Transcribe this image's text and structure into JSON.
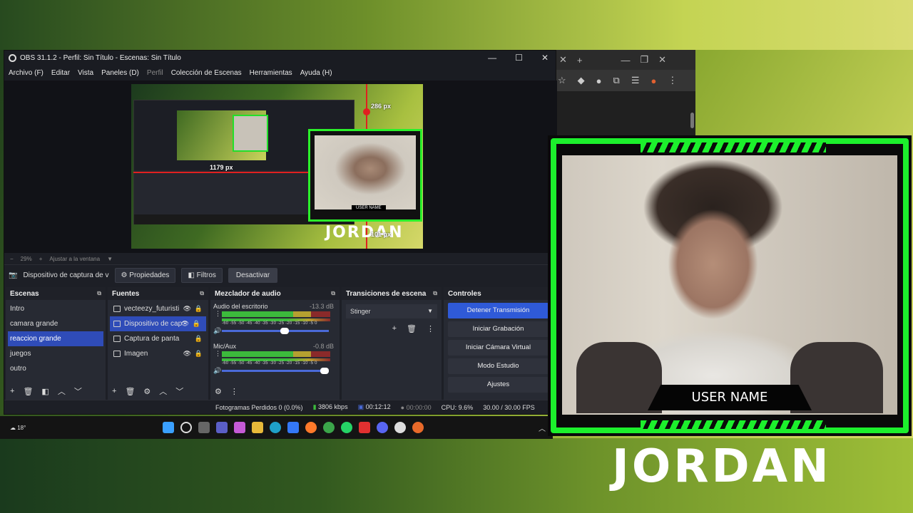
{
  "obs": {
    "title": "OBS 31.1.2 - Perfil: Sin Título - Escenas: Sin Título",
    "window_controls": [
      "—",
      "☐",
      "✕"
    ],
    "menu": [
      "Archivo (F)",
      "Editar",
      "Vista",
      "Paneles (D)",
      "Perfil",
      "Colección de Escenas",
      "Herramientas",
      "Ayuda (H)"
    ],
    "preview": {
      "measure_h": "1179 px",
      "measure_v_top": "286 px",
      "measure_v_bottom": "101 px",
      "cam_username": "USER NAME",
      "logo": "JORDAN"
    },
    "zoom": {
      "minus": "−",
      "value": "29%",
      "plus": "+",
      "fit": "Ajustar a la ventana"
    },
    "source_bar": {
      "selected": "Dispositivo de captura de v",
      "properties": "Propiedades",
      "filters": "Filtros",
      "deactivate": "Desactivar"
    },
    "scenes": {
      "title": "Escenas",
      "items": [
        "Intro",
        "camara grande",
        "reaccion grande",
        "juegos",
        "outro"
      ],
      "selected_index": 2
    },
    "sources": {
      "title": "Fuentes",
      "items": [
        "vecteezy_futuristi",
        "Dispositivo de cap",
        "Captura de panta",
        "Imagen"
      ],
      "selected_index": 1
    },
    "mixer": {
      "title": "Mezclador de audio",
      "channels": [
        {
          "name": "Audio del escritorio",
          "db": "-13.3 dB",
          "volume": 0.58
        },
        {
          "name": "Mic/Aux",
          "db": "-0.8 dB",
          "volume": 0.95
        }
      ],
      "ticks": "-60 -55 -50 -45 -40 -35 -30 -25 -20 -15 -10 -5 0"
    },
    "transitions": {
      "title": "Transiciones de escena",
      "selected": "Stinger"
    },
    "controls": {
      "title": "Controles",
      "buttons": [
        "Detener Transmisión",
        "Iniciar Grabación",
        "Iniciar Cámara Virtual",
        "Modo Estudio",
        "Ajustes"
      ]
    },
    "status": {
      "frames": "Fotogramas Perdidos 0 (0.0%)",
      "bitrate": "3806 kbps",
      "stream_time": "00:12:12",
      "rec_time": "00:00:00",
      "cpu": "CPU: 9.6%",
      "fps": "30.00 / 30.00 FPS"
    }
  },
  "taskbar": {
    "weather": "18°"
  },
  "overlay": {
    "username": "USER NAME",
    "logo": "JORDAN"
  },
  "colors": {
    "accent_green": "#1cf02c",
    "obs_blue": "#2f4cb8"
  }
}
